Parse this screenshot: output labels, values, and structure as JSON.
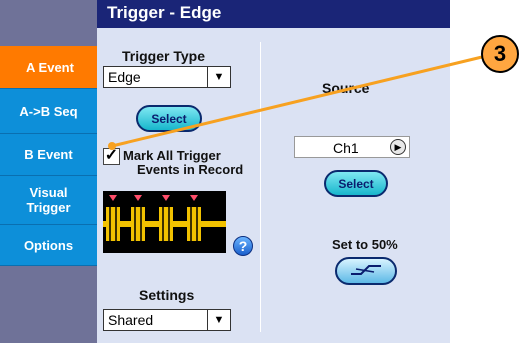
{
  "window": {
    "title": "Trigger - Edge"
  },
  "nav": {
    "items": [
      {
        "label": "A Event",
        "active": true
      },
      {
        "label": "A->B Seq",
        "active": false
      },
      {
        "label": "B Event",
        "active": false
      },
      {
        "label": "Visual Trigger",
        "active": false
      },
      {
        "label": "Options",
        "active": false
      }
    ]
  },
  "trigger_type": {
    "label": "Trigger Type",
    "value": "Edge",
    "select_label": "Select"
  },
  "mark_all": {
    "checked": true,
    "label_line1": "Mark All Trigger",
    "label_line2": "Events in Record"
  },
  "settings": {
    "label": "Settings",
    "value": "Shared"
  },
  "source": {
    "label": "Source",
    "value": "Ch1",
    "select_label": "Select"
  },
  "set_level": {
    "label": "Set to 50%"
  },
  "callout": {
    "number": "3"
  },
  "colors": {
    "accent_orange": "#ff7a00",
    "nav_blue": "#0d8fd9",
    "title_bar": "#1a2577",
    "panel_bg": "#dbe2f3",
    "waveform": "#f2c200",
    "callout_line": "#f7a120"
  },
  "icons": {
    "dropdown": "triangle-down-icon",
    "source_arrow": "triangle-right-icon",
    "help": "question-mark-icon",
    "edge_symbol": "rising-edge-icon"
  }
}
